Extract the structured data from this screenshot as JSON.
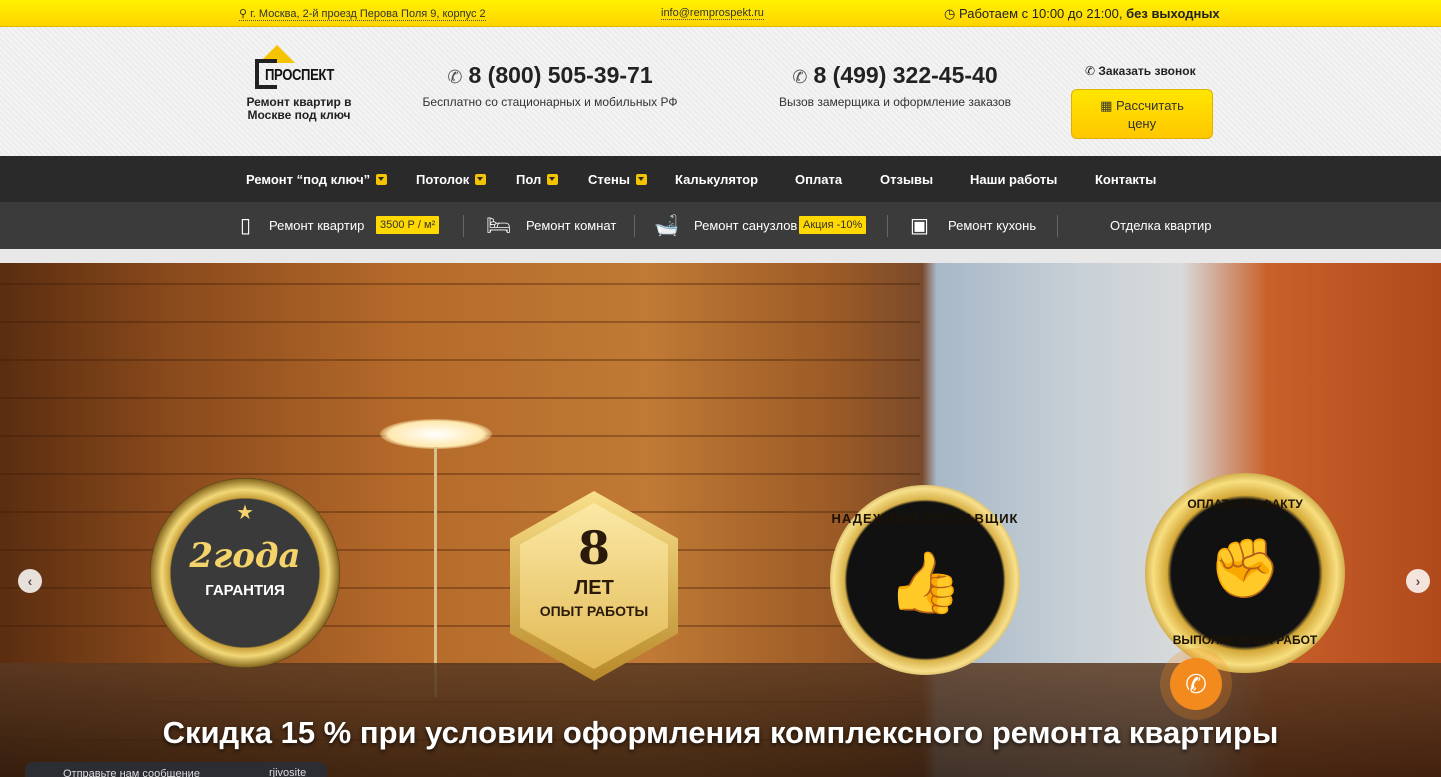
{
  "topbar": {
    "address": "г. Москва, 2-й проезд Перова Поля 9, корпус 2",
    "email": "info@remprospekt.ru",
    "hours_prefix": "Работаем с 10:00 до 21:00,",
    "hours_bold": "без выходных"
  },
  "header": {
    "logo_text": "ПРОСПЕКТ",
    "tagline": "Ремонт квартир в Москве под ключ",
    "phone1": "8 (800) 505-39-71",
    "phone1_desc": "Бесплатно со стационарных и мобильных РФ",
    "phone2": "8 (499) 322-45-40",
    "phone2_desc": "Вызов замерщика и оформление заказов",
    "callback_label": "Заказать звонок",
    "calc_label_line1": "Рассчитать",
    "calc_label_line2": "цену"
  },
  "mainnav": {
    "items": [
      {
        "label": "Ремонт “под ключ”"
      },
      {
        "label": "Потолок"
      },
      {
        "label": "Пол"
      },
      {
        "label": "Стены"
      },
      {
        "label": "Калькулятор"
      },
      {
        "label": "Оплата"
      },
      {
        "label": "Отзывы"
      },
      {
        "label": "Наши работы"
      },
      {
        "label": "Контакты"
      }
    ]
  },
  "subnav": {
    "items": [
      {
        "label": "Ремонт квартир",
        "badge": "3500 Р / м²"
      },
      {
        "label": "Ремонт комнат"
      },
      {
        "label": "Ремонт санузлов",
        "badge": "Акция -10%"
      },
      {
        "label": "Ремонт кухонь"
      },
      {
        "label": "Отделка квартир"
      }
    ]
  },
  "hero": {
    "medal1_big": "2года",
    "medal1_small": "ГАРАНТИЯ",
    "medal2_big": "8",
    "medal2_line1": "ЛЕТ",
    "medal2_line2": "ОПЫТ РАБОТЫ",
    "medal3_text": "НАДЕЖНЫЙ ПОСТАВЩИК",
    "medal4_top": "ОПЛАТА ПО ФАКТУ",
    "medal4_bottom": "ВЫПОЛНЕННЫХ РАБОТ",
    "promo": "Скидка 15 %  при условии  оформления комплексного ремонта квартиры"
  },
  "chat": {
    "label": "Отправьте нам сообщение",
    "tail": "rjivosite"
  },
  "colors": {
    "accent": "#ffd800",
    "nav_bg": "#2a2a2a",
    "subnav_bg": "#3b3b3b"
  }
}
